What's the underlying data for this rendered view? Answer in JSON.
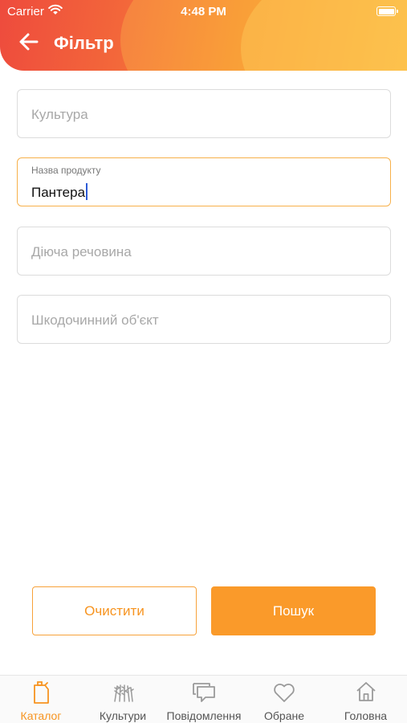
{
  "status_bar": {
    "carrier": "Carrier",
    "time": "4:48 PM"
  },
  "header": {
    "title": "Фільтр",
    "back_icon": "arrow-left-icon"
  },
  "form": {
    "culture": {
      "placeholder": "Культура",
      "value": ""
    },
    "product_name": {
      "label": "Назва продукту",
      "value": "Пантера"
    },
    "active_substance": {
      "placeholder": "Діюча речовина",
      "value": ""
    },
    "harmful_object": {
      "placeholder": "Шкодочинний об'єкт",
      "value": ""
    }
  },
  "actions": {
    "clear_label": "Очистити",
    "search_label": "Пошук"
  },
  "tabbar": {
    "items": [
      {
        "label": "Каталог",
        "icon": "canister-icon",
        "active": true
      },
      {
        "label": "Культури",
        "icon": "wheat-icon",
        "active": false
      },
      {
        "label": "Повідомлення",
        "icon": "chat-icon",
        "active": false
      },
      {
        "label": "Обране",
        "icon": "heart-icon",
        "active": false
      },
      {
        "label": "Головна",
        "icon": "home-icon",
        "active": false
      }
    ]
  },
  "colors": {
    "accent": "#F79420",
    "header_gradient_start": "#EE4B3D",
    "header_gradient_end": "#FBB03A",
    "active_border": "#F7B04A"
  }
}
